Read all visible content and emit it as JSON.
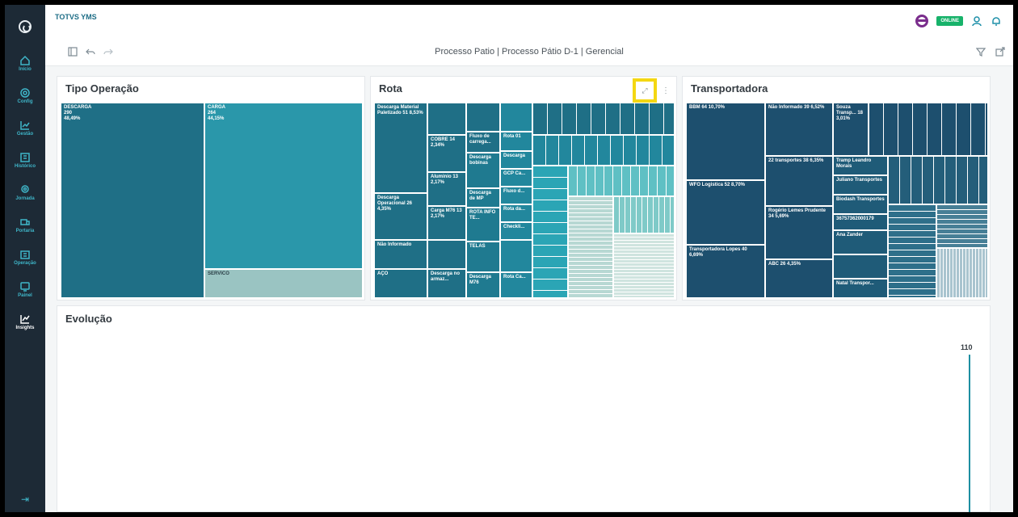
{
  "app": {
    "title": "TOTVS YMS",
    "status": "ONLINE"
  },
  "sidebar": {
    "items": [
      {
        "label": "Início",
        "icon": "home-icon"
      },
      {
        "label": "Config",
        "icon": "gear-icon"
      },
      {
        "label": "Gestão",
        "icon": "chart-icon"
      },
      {
        "label": "Histórico",
        "icon": "history-icon"
      },
      {
        "label": "Jornada",
        "icon": "location-icon"
      },
      {
        "label": "Portaria",
        "icon": "truck-icon"
      },
      {
        "label": "Operação",
        "icon": "building-icon"
      },
      {
        "label": "Painel",
        "icon": "monitor-icon"
      },
      {
        "label": "Insights",
        "icon": "insights-icon",
        "active": true
      }
    ]
  },
  "dashboard": {
    "title": "Processo Patio | Processo Pátio D-1 | Gerencial"
  },
  "cards": {
    "tipo": {
      "title": "Tipo Operação"
    },
    "rota": {
      "title": "Rota"
    },
    "transp": {
      "title": "Transportadora"
    },
    "evolucao": {
      "title": "Evolução",
      "value": "110"
    }
  },
  "tipo_cells": [
    {
      "name": "DESCARGA",
      "count": "290",
      "pct": "48,49%"
    },
    {
      "name": "CARGA",
      "count": "264",
      "pct": "44,15%"
    },
    {
      "name": "SERVICO"
    }
  ],
  "rota_cells": [
    {
      "text": "Descarga Material Paletizado 51 8,53%"
    },
    {
      "text": "Descarga Operacional 26 4,35%"
    },
    {
      "text": "Não Informado"
    },
    {
      "text": "AÇO"
    },
    {
      "text": "COBRE 14 2,34%"
    },
    {
      "text": "Aluminio 13 2,17%"
    },
    {
      "text": "Carga M76 13 2,17%"
    },
    {
      "text": "Descarga no armaz..."
    },
    {
      "text": "Fluxo de carrega..."
    },
    {
      "text": "Descarga bobinas"
    },
    {
      "text": "Descarga de MP"
    },
    {
      "text": "ROTA INFO TE..."
    },
    {
      "text": "TELAS"
    },
    {
      "text": "Descarga M76"
    },
    {
      "text": "Rota 01"
    },
    {
      "text": "Descarga"
    },
    {
      "text": "GCP Ca..."
    },
    {
      "text": "Fluxo d..."
    },
    {
      "text": "Rota da..."
    },
    {
      "text": "Checkli..."
    },
    {
      "text": "Rota Ca..."
    }
  ],
  "transp_cells": [
    {
      "text": "BBM 64 10,70%"
    },
    {
      "text": "WFO Logistica 52 8,70%"
    },
    {
      "text": "Transportadora Lopes 40 6,69%"
    },
    {
      "text": "Não Informado 39 6,52%"
    },
    {
      "text": "22 transportes 38 6,35%"
    },
    {
      "text": "Rogério Lemes Prudente 34 5,69%"
    },
    {
      "text": "ABC 26 4,35%"
    },
    {
      "text": "Souza Transp... 18 3,01%"
    },
    {
      "text": "Tramp Leandro Morais"
    },
    {
      "text": "Juliano Transportes"
    },
    {
      "text": "Biodash Transportes"
    },
    {
      "text": "36757362000179"
    },
    {
      "text": "Ana Zander"
    },
    {
      "text": "Natal Transpor..."
    }
  ]
}
